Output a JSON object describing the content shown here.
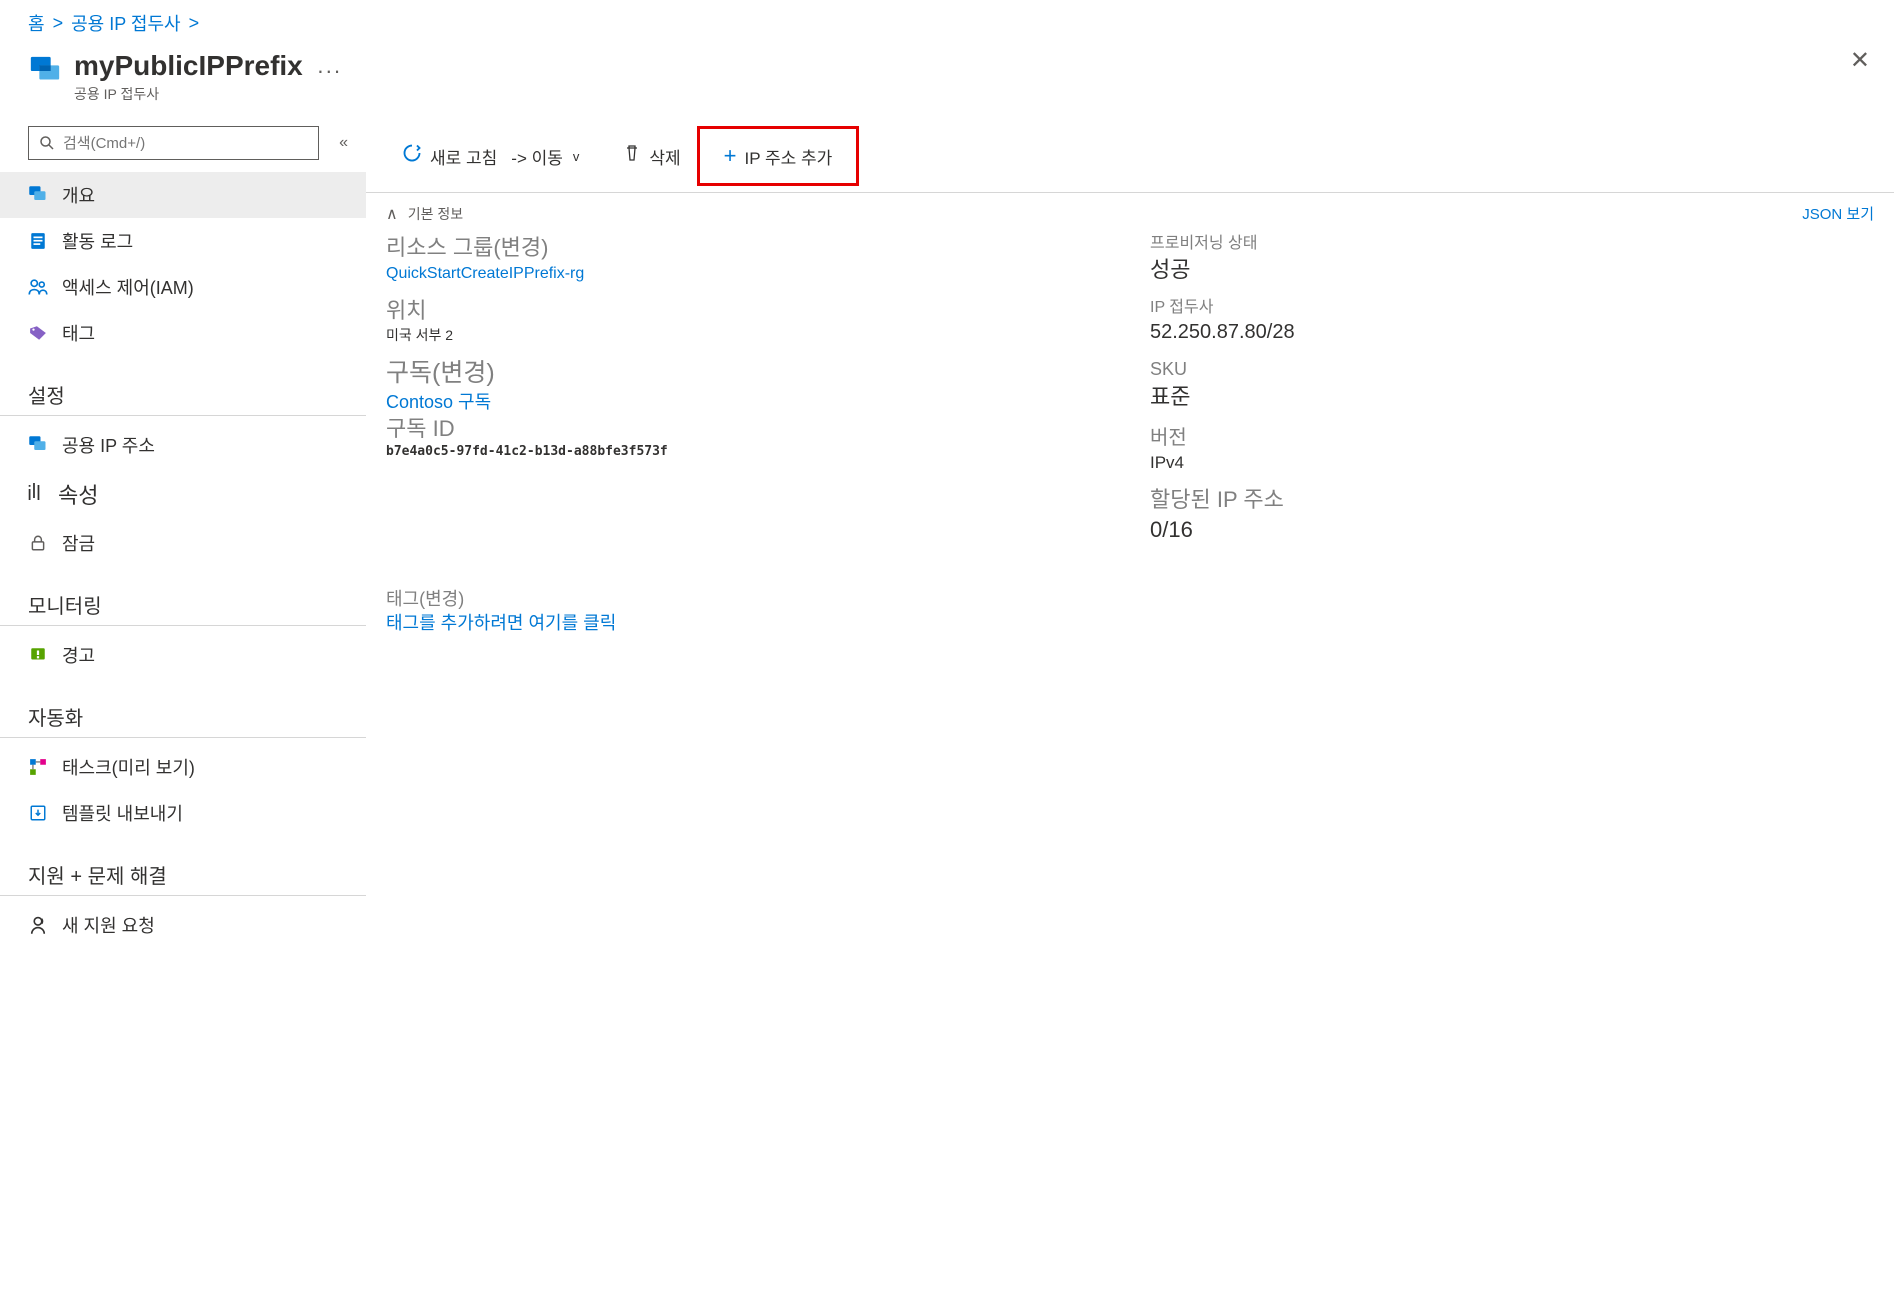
{
  "breadcrumb": {
    "home": "홈",
    "parent": "공용 IP 접두사"
  },
  "header": {
    "title": "myPublicIPPrefix",
    "subtitle": "공용 IP 접두사"
  },
  "search": {
    "placeholder": "검색(Cmd+/)"
  },
  "nav": {
    "overview": "개요",
    "activityLog": "활동 로그",
    "iam": "액세스 제어(IAM)",
    "tags": "태그",
    "settings": "설정",
    "publicIpAddr": "공용 IP 주소",
    "properties": "속성",
    "locks": "잠금",
    "monitoring": "모니터링",
    "alerts": "경고",
    "automation": "자동화",
    "tasks": "태스크(미리 보기)",
    "exportTemplate": "템플릿 내보내기",
    "support": "지원 + 문제 해결",
    "newSupport": "새 지원 요청"
  },
  "toolbar": {
    "refresh": "새로 고침",
    "move": "-> 이동",
    "delete": "삭제",
    "addIp": "IP 주소 추가"
  },
  "essentials": {
    "toggle": "기본 정보",
    "jsonView": "JSON 보기",
    "resourceGroup": {
      "label": "리소스 그룹(변경)",
      "value": "QuickStartCreateIPPrefix-rg"
    },
    "location": {
      "label": "위치",
      "value": "미국 서부 2"
    },
    "subscription": {
      "label": "구독(변경)",
      "value": "Contoso 구독"
    },
    "subscriptionId": {
      "label": "구독 ID",
      "value": "b7e4a0c5-97fd-41c2-b13d-a88bfe3f573f"
    },
    "provisioningState": {
      "label": "프로비저닝 상태",
      "value": "성공"
    },
    "ipPrefix": {
      "label": "IP 접두사",
      "value": "52.250.87.80/28"
    },
    "sku": {
      "label": "SKU",
      "value": "표준"
    },
    "version": {
      "label": "버전",
      "value": "IPv4"
    },
    "allocated": {
      "label": "할당된 IP 주소",
      "value": "0/16"
    },
    "tags": {
      "label": "태그(변경)",
      "value": "태그를 추가하려면 여기를 클릭"
    }
  }
}
